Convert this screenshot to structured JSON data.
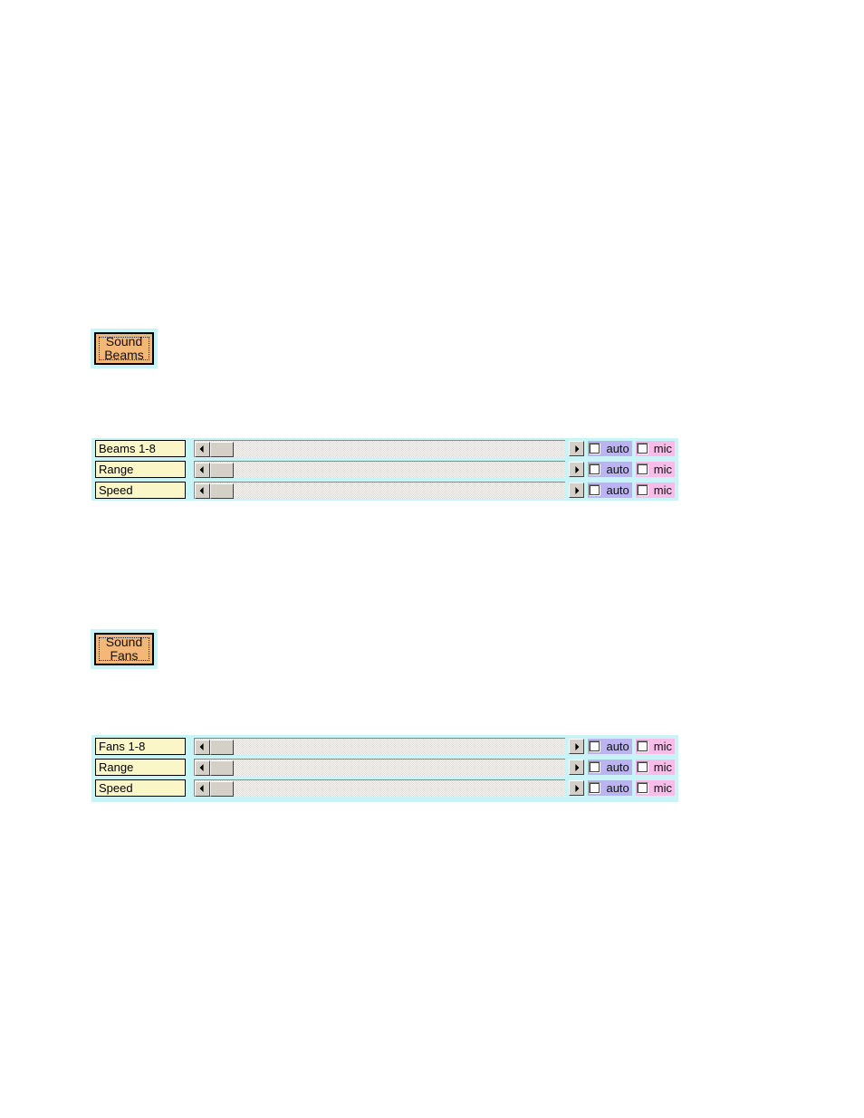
{
  "page": {
    "background_color": "#ffffff",
    "panel_background_color": "#c8f4f8",
    "button_face_color": "#f5b775",
    "label_field_color": "#fbf6c8",
    "auto_swatch_color": "#bbb4f0",
    "mic_swatch_color": "#f7bde8",
    "scrollbar_face_color": "#d4d0c8"
  },
  "buttons": [
    {
      "name": "sound-beams-button",
      "line1": "Sound",
      "line2": "Beams",
      "focused": true
    },
    {
      "name": "sound-fans-button",
      "line1": "Sound",
      "line2": "Fans",
      "focused": true
    }
  ],
  "panels": [
    {
      "name": "sound-beams-panel",
      "rows": [
        {
          "label": "Beams 1-8",
          "slider": {
            "left_arrow": "◄",
            "right_arrow": "►",
            "thumb_position": 0
          },
          "auto": {
            "label": "auto",
            "checked": false
          },
          "mic": {
            "label": "mic",
            "checked": false
          }
        },
        {
          "label": "Range",
          "slider": {
            "left_arrow": "◄",
            "right_arrow": "►",
            "thumb_position": 0
          },
          "auto": {
            "label": "auto",
            "checked": false
          },
          "mic": {
            "label": "mic",
            "checked": false
          }
        },
        {
          "label": "Speed",
          "slider": {
            "left_arrow": "◄",
            "right_arrow": "►",
            "thumb_position": 0
          },
          "auto": {
            "label": "auto",
            "checked": false
          },
          "mic": {
            "label": "mic",
            "checked": false
          }
        }
      ]
    },
    {
      "name": "sound-fans-panel",
      "rows": [
        {
          "label": "Fans 1-8",
          "slider": {
            "left_arrow": "◄",
            "right_arrow": "►",
            "thumb_position": 0
          },
          "auto": {
            "label": "auto",
            "checked": false
          },
          "mic": {
            "label": "mic",
            "checked": false
          }
        },
        {
          "label": "Range",
          "slider": {
            "left_arrow": "◄",
            "right_arrow": "►",
            "thumb_position": 0
          },
          "auto": {
            "label": "auto",
            "checked": false
          },
          "mic": {
            "label": "mic",
            "checked": false
          }
        },
        {
          "label": "Speed",
          "slider": {
            "left_arrow": "◄",
            "right_arrow": "►",
            "thumb_position": 0
          },
          "auto": {
            "label": "auto",
            "checked": false
          },
          "mic": {
            "label": "mic",
            "checked": false
          }
        }
      ]
    }
  ]
}
